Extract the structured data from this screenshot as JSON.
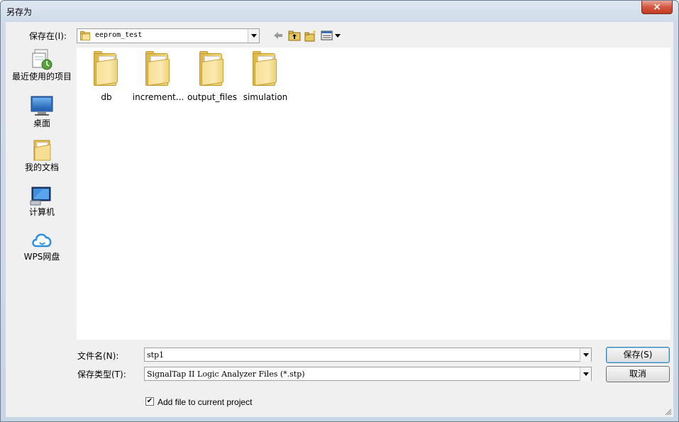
{
  "window": {
    "title": "另存为",
    "close_glyph": "×"
  },
  "save_in": {
    "label": "保存在(I):",
    "value": "eeprom_test"
  },
  "toolbar": {
    "back_icon": "back-arrow-icon",
    "up_icon": "up-folder-icon",
    "new_folder_icon": "new-folder-icon",
    "view_icon": "view-menu-icon"
  },
  "places": [
    {
      "label": "最近使用的项目",
      "icon": "recent-items-icon"
    },
    {
      "label": "桌面",
      "icon": "desktop-icon"
    },
    {
      "label": "我的文档",
      "icon": "documents-folder-icon"
    },
    {
      "label": "计算机",
      "icon": "computer-icon"
    },
    {
      "label": "WPS网盘",
      "icon": "cloud-icon"
    }
  ],
  "files": [
    {
      "label": "db",
      "icon": "folder-icon"
    },
    {
      "label": "increment...",
      "icon": "folder-icon"
    },
    {
      "label": "output_files",
      "icon": "folder-icon"
    },
    {
      "label": "simulation",
      "icon": "folder-icon"
    }
  ],
  "file_name": {
    "label": "文件名(N):",
    "value": "stp1"
  },
  "file_type": {
    "label": "保存类型(T):",
    "value": "SignalTap II Logic Analyzer Files (*.stp)"
  },
  "buttons": {
    "save": "保存(S)",
    "cancel": "取消"
  },
  "add_to_project": {
    "label": "Add file to current project",
    "checked": true,
    "check_glyph": "✔"
  },
  "colors": {
    "accent": "#3c7fb1",
    "close": "#c13a23",
    "folder": "#f1d67c"
  }
}
